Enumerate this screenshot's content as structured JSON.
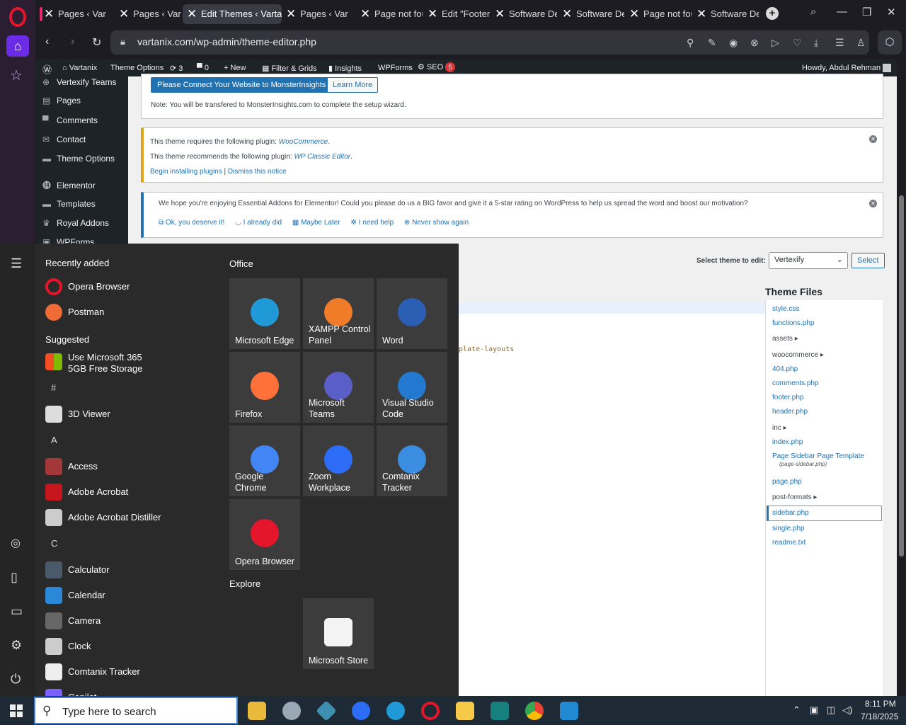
{
  "browser": {
    "tabs": [
      {
        "title": "Pages ‹ Varta",
        "active": false
      },
      {
        "title": "Pages ‹ Varta",
        "active": false
      },
      {
        "title": "Edit Themes ‹ Vartan",
        "active": true
      },
      {
        "title": "Pages ‹ Varta",
        "active": false
      },
      {
        "title": "Page not fou",
        "active": false
      },
      {
        "title": "Edit \"Footer",
        "active": false
      },
      {
        "title": "Software De",
        "active": false
      },
      {
        "title": "Software De",
        "active": false
      },
      {
        "title": "Page not fou",
        "active": false
      },
      {
        "title": "Software De",
        "active": false
      }
    ],
    "url": "vartanix.com/wp-admin/theme-editor.php"
  },
  "wp_admin_bar": {
    "site": "Vartanix",
    "theme_options": "Theme Options",
    "updates": "3",
    "comments": "0",
    "new": "New",
    "filter": "Filter & Grids",
    "insights": "Insights",
    "wpforms": "WPForms",
    "seo": "SEO",
    "seo_badge": "5",
    "howdy": "Howdy, Abdul Rehman"
  },
  "wp_menu": [
    "Vertexify Teams",
    "Pages",
    "Comments",
    "Contact",
    "Theme Options",
    "Elementor",
    "Templates",
    "Royal Addons",
    "WPForms"
  ],
  "notices": {
    "monster": {
      "connect_btn": "Please Connect Your Website to MonsterInsights",
      "learn_btn": "Learn More",
      "note": "Note: You will be transfered to MonsterInsights.com to complete the setup wizard."
    },
    "plugin": {
      "req_prefix": "This theme requires the following plugin: ",
      "req_link": "WooCommerce",
      "rec_prefix": "This theme recommends the following plugin: ",
      "rec_link": "WP Classic Editor",
      "begin": "Begin installing plugins",
      "sep": " | ",
      "dismiss": "Dismiss this notice"
    },
    "ea": {
      "text": "We hope you're enjoying Essential Addons for Elementor! Could you please do us a BIG favor and give it a 5-star rating on WordPress to help us spread the word and boost our motivation?",
      "ok": "Ok, you deserve it!",
      "already": "I already did",
      "later": "Maybe Later",
      "help": "I need help",
      "never": "Never show again"
    }
  },
  "theme_editor": {
    "select_label": "Select theme to edit:",
    "selected_theme": "Vertexify",
    "select_btn": "Select",
    "files_title": "Theme Files",
    "code_fragment": "plate-layouts",
    "files": [
      {
        "name": "style.css",
        "dir": false
      },
      {
        "name": "functions.php",
        "dir": false
      },
      {
        "name": "assets",
        "dir": true
      },
      {
        "name": "woocommerce",
        "dir": true
      },
      {
        "name": "404.php",
        "dir": false
      },
      {
        "name": "comments.php",
        "dir": false
      },
      {
        "name": "footer.php",
        "dir": false
      },
      {
        "name": "header.php",
        "dir": false
      },
      {
        "name": "inc",
        "dir": true
      },
      {
        "name": "index.php",
        "dir": false
      },
      {
        "name": "Page Sidebar Page Template",
        "dir": false,
        "sub": "(page-sidebar.php)"
      },
      {
        "name": "page.php",
        "dir": false
      },
      {
        "name": "post-formats",
        "dir": true
      },
      {
        "name": "sidebar.php",
        "dir": false,
        "selected": true
      },
      {
        "name": "single.php",
        "dir": false
      },
      {
        "name": "readme.txt",
        "dir": false
      }
    ]
  },
  "start_menu": {
    "recent_title": "Recently added",
    "recent": [
      "Opera Browser",
      "Postman"
    ],
    "suggested_title": "Suggested",
    "suggested": [
      "Use Microsoft 365",
      "5GB Free Storage"
    ],
    "groups": [
      {
        "letter": "#",
        "apps": [
          "3D Viewer"
        ]
      },
      {
        "letter": "A",
        "apps": [
          "Access",
          "Adobe Acrobat",
          "Adobe Acrobat Distiller"
        ]
      },
      {
        "letter": "C",
        "apps": [
          "Calculator",
          "Calendar",
          "Camera",
          "Clock",
          "Comtanix Tracker",
          "Copilot"
        ]
      }
    ],
    "office_title": "Office",
    "tiles": [
      "Microsoft Edge",
      "XAMPP Control Panel",
      "Word",
      "Firefox",
      "Microsoft Teams",
      "Visual Studio Code",
      "Google Chrome",
      "Zoom Workplace",
      "Comtanix Tracker",
      "Opera Browser"
    ],
    "explore_title": "Explore",
    "explore_tiles": [
      "Microsoft Store"
    ]
  },
  "taskbar": {
    "search_placeholder": "Type here to search",
    "time": "8:11 PM",
    "date": "7/18/2025"
  }
}
